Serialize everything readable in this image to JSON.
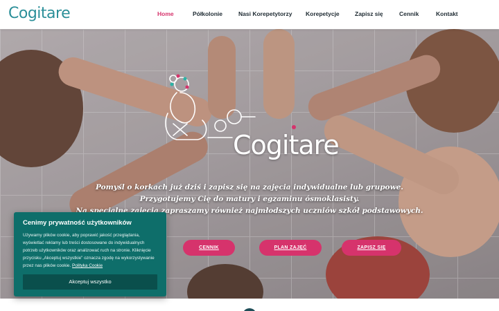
{
  "header": {
    "logo_text": "Cogitare",
    "nav": [
      {
        "label": "Home",
        "active": true
      },
      {
        "label": "Półkolonie",
        "active": false
      },
      {
        "label": "Nasi Korepetytorzy",
        "active": false
      },
      {
        "label": "Korepetycje",
        "active": false
      },
      {
        "label": "Zapisz się",
        "active": false
      },
      {
        "label": "Cennik",
        "active": false
      },
      {
        "label": "Kontakt",
        "active": false
      }
    ]
  },
  "hero": {
    "brand": "Cogitare",
    "lines": [
      "Pomyśl o korkach już dziś i zapisz się na zajęcia indywidualne lub grupowe.",
      "Przygotujemy Cię do matury i egzaminu ósmoklasisty.",
      "Na specjalne zajęcia zapraszamy również najmłodszych uczniów szkół podstawowych."
    ],
    "buttons": [
      {
        "label": "CENNIK"
      },
      {
        "label": "PLAN ZAJĘĆ"
      },
      {
        "label": "ZAPISZ SIĘ"
      }
    ]
  },
  "cookie": {
    "title": "Cenimy prywatność użytkowników",
    "body": "Używamy plików cookie, aby poprawić jakość przeglądania, wyświetlać reklamy lub treści dostosowane do indywidualnych potrzeb użytkowników oraz analizować ruch na stronie. Kliknięcie przycisku „Akceptuj wszystkie” oznacza zgodę na wykorzystywanie przez nas plików cookie.",
    "link": "Polityka Cookie",
    "accept": "Akceptuj wszystko"
  },
  "colors": {
    "accent": "#d6336c",
    "teal": "#0e6e6a",
    "logo": "#2b8f99"
  }
}
